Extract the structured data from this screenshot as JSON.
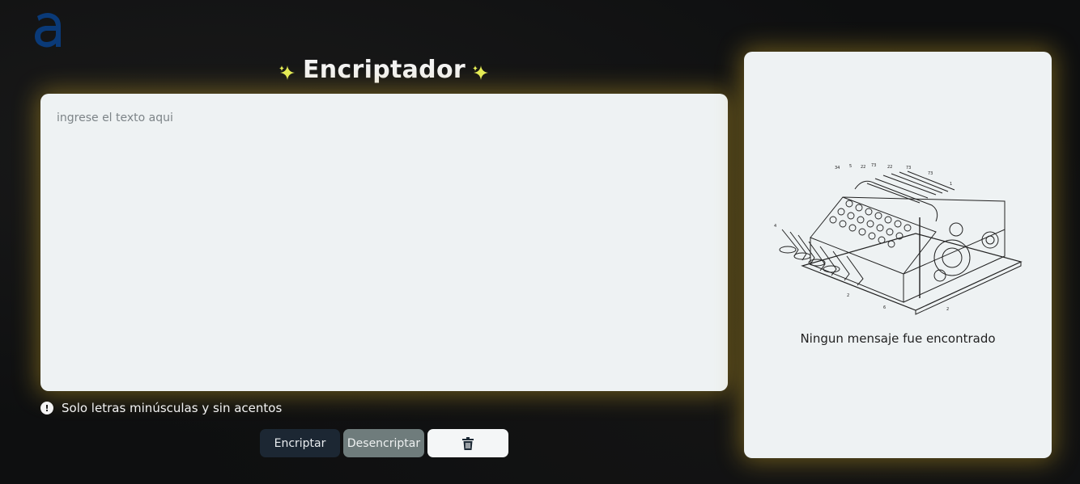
{
  "brand": {
    "logo_icon": "alura-logo-icon",
    "color": "#0a3a78"
  },
  "header": {
    "title": "Encriptador",
    "sparkle_color": "#e6ee57"
  },
  "input": {
    "placeholder": "ingrese el texto aqui",
    "value": ""
  },
  "notice": {
    "icon": "exclamation-circle-icon",
    "text": "Solo letras minúsculas y sin acentos"
  },
  "buttons": {
    "encrypt_label": "Encriptar",
    "decrypt_label": "Desencriptar",
    "delete_icon": "trash-icon"
  },
  "output": {
    "image_icon": "cipher-machine-illustration",
    "empty_message": "Ningun mensaje fue encontrado"
  },
  "colors": {
    "background": "#0e0f10",
    "panel": "#eef2f3",
    "glow": "#d2aa28",
    "btn_primary": "#1c2733",
    "btn_secondary": "#6f7c7c"
  }
}
